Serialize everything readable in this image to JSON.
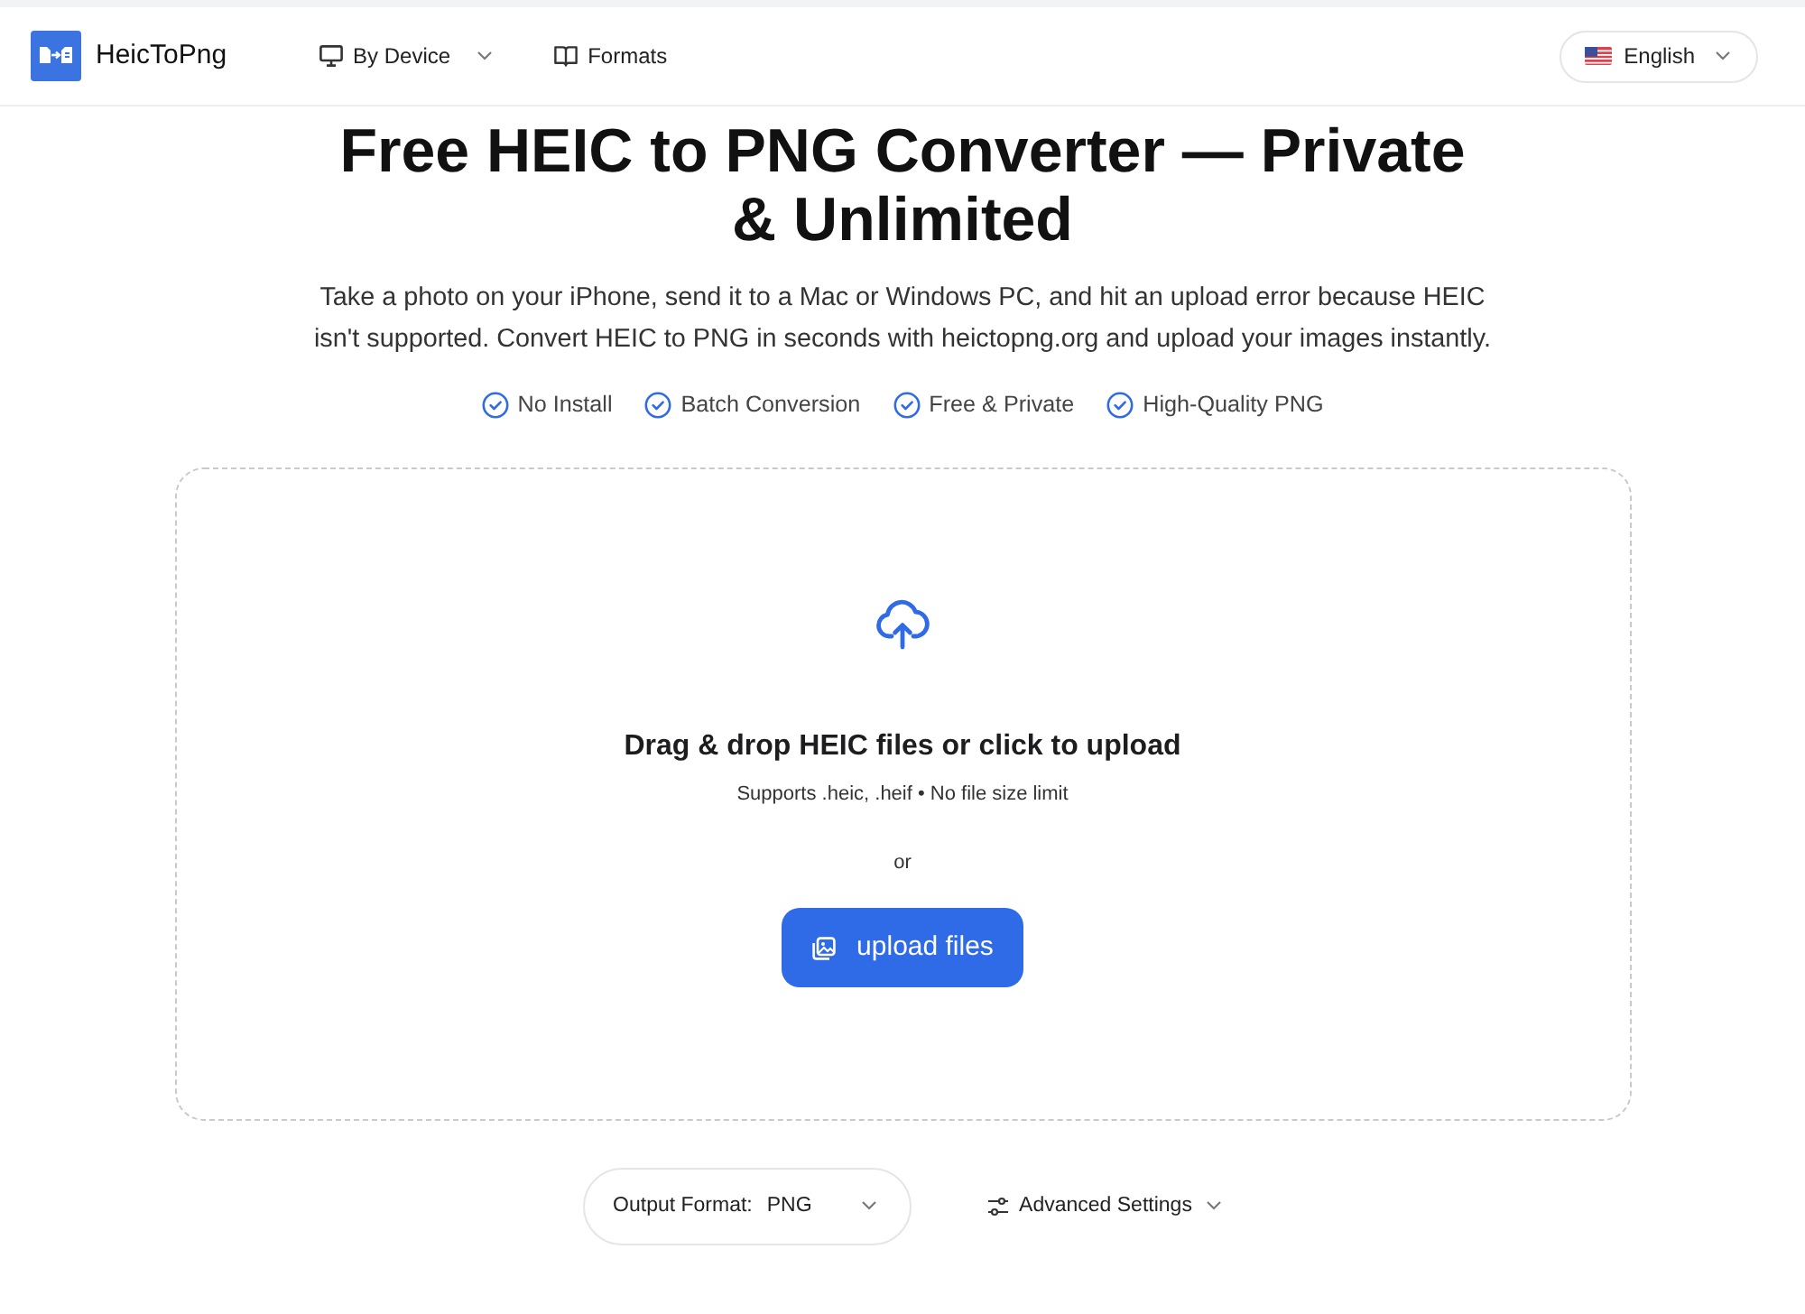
{
  "header": {
    "logo": {
      "name": "HeicToPng"
    },
    "nav": [
      {
        "label": "By Device",
        "dropdown": true
      },
      {
        "label": "Formats",
        "dropdown": false
      }
    ],
    "language": {
      "label": "English",
      "dropdown": true
    }
  },
  "hero": {
    "title": "Free HEIC to PNG Converter — Private & Unlimited",
    "description": "Take a photo on your iPhone, send it to a Mac or Windows PC, and hit an upload error because HEIC isn't supported. Convert HEIC to PNG in seconds with heictopng.org and upload your images instantly.",
    "features": [
      "No Install",
      "Batch Conversion",
      "Free & Private",
      "High-Quality PNG"
    ]
  },
  "dropzone": {
    "heading": "Drag & drop HEIC files or click to upload",
    "subtext": "Supports .heic, .heif • No file size limit",
    "separator": "or",
    "button": "upload files"
  },
  "options": {
    "output_format": {
      "label": "Output Format:",
      "value": "PNG"
    },
    "advanced": {
      "label": "Advanced Settings",
      "expanded": false
    }
  }
}
